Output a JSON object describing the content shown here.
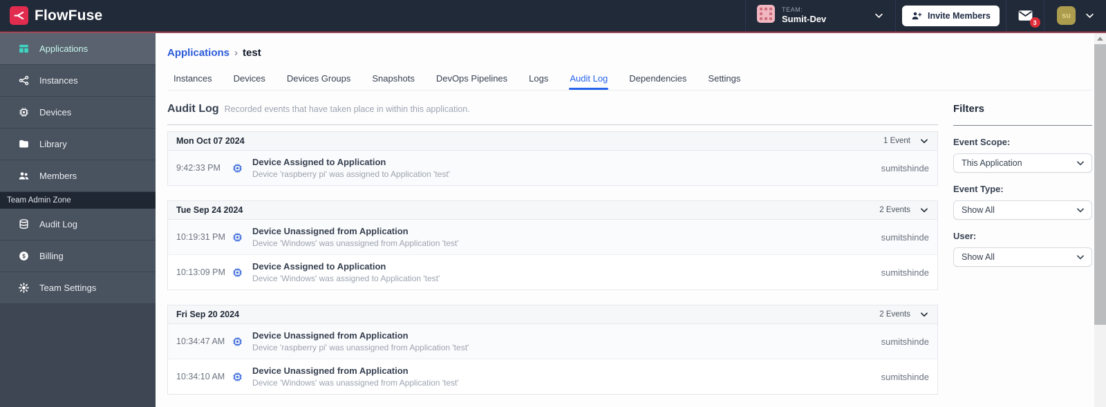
{
  "header": {
    "brand": "FlowFuse",
    "team_label": "TEAM:",
    "team_name": "Sumit-Dev",
    "invite_button": "Invite Members",
    "notification_count": "3",
    "avatar_initials": "su"
  },
  "sidebar": {
    "items": [
      {
        "label": "Applications",
        "icon": "applications",
        "active": true
      },
      {
        "label": "Instances",
        "icon": "instances",
        "active": false
      },
      {
        "label": "Devices",
        "icon": "chip",
        "active": false
      },
      {
        "label": "Library",
        "icon": "folder",
        "active": false
      },
      {
        "label": "Members",
        "icon": "users",
        "active": false
      }
    ],
    "section_label": "Team Admin Zone",
    "admin_items": [
      {
        "label": "Audit Log",
        "icon": "database"
      },
      {
        "label": "Billing",
        "icon": "dollar"
      },
      {
        "label": "Team Settings",
        "icon": "gear"
      }
    ]
  },
  "breadcrumb": {
    "parent": "Applications",
    "separator": "›",
    "current": "test"
  },
  "tabs": [
    "Instances",
    "Devices",
    "Devices Groups",
    "Snapshots",
    "DevOps Pipelines",
    "Logs",
    "Audit Log",
    "Dependencies",
    "Settings"
  ],
  "active_tab": "Audit Log",
  "main": {
    "title": "Audit Log",
    "subtitle": "Recorded events that have taken place in within this application.",
    "groups": [
      {
        "date": "Mon Oct 07 2024",
        "count_label": "1 Event",
        "events": [
          {
            "time": "9:42:33 PM",
            "title": "Device Assigned to Application",
            "description": "Device 'raspberry pi' was assigned to Application 'test'",
            "user": "sumitshinde"
          }
        ]
      },
      {
        "date": "Tue Sep 24 2024",
        "count_label": "2 Events",
        "events": [
          {
            "time": "10:19:31 PM",
            "title": "Device Unassigned from Application",
            "description": "Device 'Windows' was unassigned from Application 'test'",
            "user": "sumitshinde"
          },
          {
            "time": "10:13:09 PM",
            "title": "Device Assigned to Application",
            "description": "Device 'Windows' was assigned to Application 'test'",
            "user": "sumitshinde"
          }
        ]
      },
      {
        "date": "Fri Sep 20 2024",
        "count_label": "2 Events",
        "events": [
          {
            "time": "10:34:47 AM",
            "title": "Device Unassigned from Application",
            "description": "Device 'raspberry pi' was unassigned from Application 'test'",
            "user": "sumitshinde"
          },
          {
            "time": "10:34:10 AM",
            "title": "Device Unassigned from Application",
            "description": "Device 'Windows' was unassigned from Application 'test'",
            "user": "sumitshinde"
          }
        ]
      }
    ]
  },
  "filters": {
    "title": "Filters",
    "fields": [
      {
        "label": "Event Scope:",
        "value": "This Application"
      },
      {
        "label": "Event Type:",
        "value": "Show All"
      },
      {
        "label": "User:",
        "value": "Show All"
      }
    ]
  },
  "colors": {
    "accent_blue": "#2563eb",
    "brand_red": "#e22c4f",
    "active_teal": "#3dd6c3",
    "badge_red": "#e02c38",
    "header_bg": "#212a38",
    "sidebar_bg": "#49525f"
  }
}
